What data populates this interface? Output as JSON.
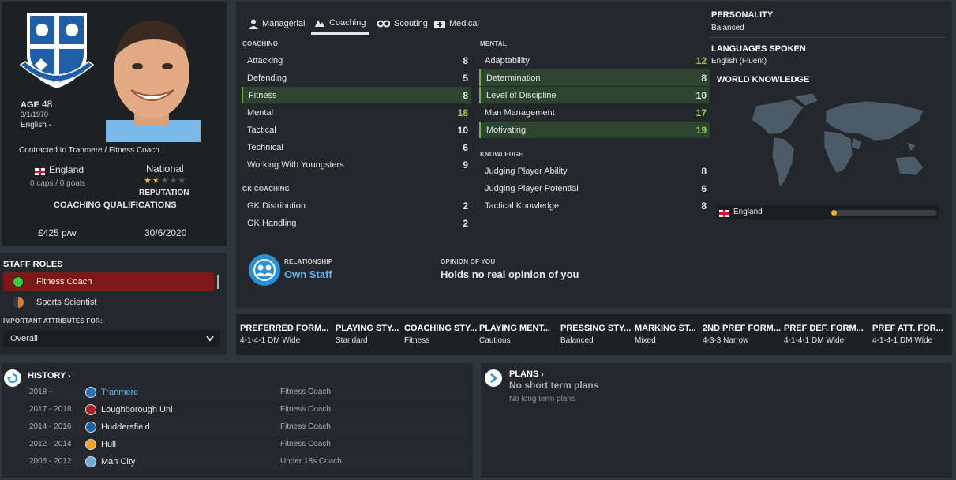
{
  "profile": {
    "age_label": "AGE",
    "age": "48",
    "dob": "3/1/1970",
    "nationality_text": "English -",
    "contract": "Contracted to Tranmere / Fitness Coach",
    "country": "England",
    "caps": "0 caps / 0 goals",
    "reputation_level": "National",
    "reputation_label": "REPUTATION",
    "reputation_stars": 1.5,
    "qualifications_label": "COACHING QUALIFICATIONS",
    "wage": "£425 p/w",
    "contract_end": "30/6/2020"
  },
  "staff_roles": {
    "title": "STAFF ROLES",
    "roles": [
      {
        "label": "Fitness Coach",
        "selected": true,
        "color": "#3ccc3c"
      },
      {
        "label": "Sports Scientist",
        "selected": false,
        "color": "#e07a1f"
      }
    ],
    "important_label": "IMPORTANT ATTRIBUTES FOR:",
    "dropdown_value": "Overall"
  },
  "tabs": [
    "Managerial",
    "Coaching",
    "Scouting",
    "Medical"
  ],
  "active_tab": "Coaching",
  "coaching": {
    "title": "COACHING",
    "items": [
      {
        "label": "Attacking",
        "value": "8"
      },
      {
        "label": "Defending",
        "value": "5"
      },
      {
        "label": "Fitness",
        "value": "8",
        "highlight": true
      },
      {
        "label": "Mental",
        "value": "18",
        "good": true
      },
      {
        "label": "Tactical",
        "value": "10"
      },
      {
        "label": "Technical",
        "value": "6"
      },
      {
        "label": "Working With Youngsters",
        "value": "9"
      }
    ]
  },
  "gk_coaching": {
    "title": "GK COACHING",
    "items": [
      {
        "label": "GK Distribution",
        "value": "2"
      },
      {
        "label": "GK Handling",
        "value": "2"
      }
    ]
  },
  "mental": {
    "title": "MENTAL",
    "items": [
      {
        "label": "Adaptability",
        "value": "12",
        "good": true
      },
      {
        "label": "Determination",
        "value": "8",
        "highlight": true
      },
      {
        "label": "Level of Discipline",
        "value": "10",
        "highlight": true
      },
      {
        "label": "Man Management",
        "value": "17",
        "good": true
      },
      {
        "label": "Motivating",
        "value": "19",
        "highlight": true,
        "good": true
      }
    ]
  },
  "knowledge": {
    "title": "KNOWLEDGE",
    "items": [
      {
        "label": "Judging Player Ability",
        "value": "8"
      },
      {
        "label": "Judging Player Potential",
        "value": "6"
      },
      {
        "label": "Tactical Knowledge",
        "value": "8"
      }
    ]
  },
  "relationship": {
    "label": "RELATIONSHIP",
    "value": "Own Staff",
    "opinion_label": "OPINION OF YOU",
    "opinion_value": "Holds no real opinion of you"
  },
  "side": {
    "personality_label": "PERSONALITY",
    "personality": "Balanced",
    "languages_label": "LANGUAGES SPOKEN",
    "languages": "English (Fluent)",
    "world_label": "WORLD KNOWLEDGE",
    "knowledge_country": "England",
    "knowledge_level": 0.05
  },
  "tactics": [
    {
      "header": "PREFERRED FORM...",
      "value": "4-1-4-1 DM Wide"
    },
    {
      "header": "PLAYING STY...",
      "value": "Standard"
    },
    {
      "header": "COACHING STY...",
      "value": "Fitness"
    },
    {
      "header": "PLAYING MENT...",
      "value": "Cautious"
    },
    {
      "header": "PRESSING STY...",
      "value": "Balanced"
    },
    {
      "header": "MARKING ST...",
      "value": "Mixed"
    },
    {
      "header": "2ND PREF FORM...",
      "value": "4-3-3 Narrow"
    },
    {
      "header": "PREF DEF. FORM...",
      "value": "4-1-4-1 DM Wide"
    },
    {
      "header": "PREF ATT. FOR...",
      "value": "4-1-4-1 DM Wide"
    }
  ],
  "history": {
    "title": "HISTORY",
    "rows": [
      {
        "years": "2018 -",
        "club": "Tranmere",
        "role": "Fitness Coach",
        "badge": "#2a6fb8"
      },
      {
        "years": "2017 - 2018",
        "club": "Loughborough Uni",
        "role": "Fitness Coach",
        "badge": "#b22222"
      },
      {
        "years": "2014 - 2016",
        "club": "Huddersfield",
        "role": "Fitness Coach",
        "badge": "#1f5fa8"
      },
      {
        "years": "2012 - 2014",
        "club": "Hull",
        "role": "Fitness Coach",
        "badge": "#f0a020"
      },
      {
        "years": "2005 - 2012",
        "club": "Man City",
        "role": "Under 18s Coach",
        "badge": "#6cabdd"
      }
    ]
  },
  "plans": {
    "title": "PLANS",
    "short": "No short term plans",
    "long": "No long term plans"
  }
}
